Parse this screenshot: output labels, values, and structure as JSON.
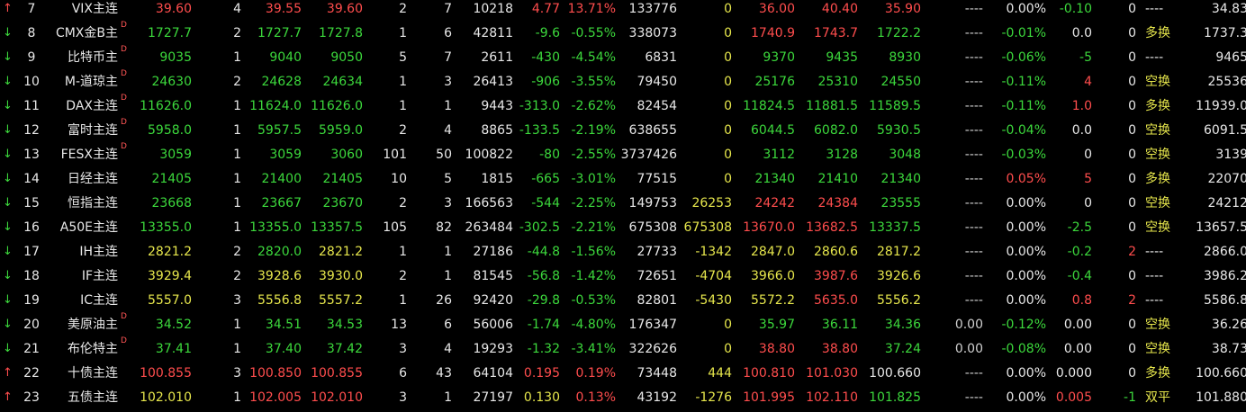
{
  "colors": {
    "background": "#000000",
    "up": "#ff4d4d",
    "down": "#3cd83c",
    "yellow": "#e6e64c",
    "white": "#e8e8e8"
  },
  "rows": [
    {
      "dir": "up",
      "idx": "7",
      "name": "VIX主连",
      "d": "",
      "last": "39.60",
      "lastc": "red",
      "bq": "4",
      "bid": "39.55",
      "bidc": "red",
      "ask": "39.60",
      "askc": "red",
      "aq": "2",
      "vol": "7",
      "total": "10218",
      "chg": "4.77",
      "chgc": "red",
      "pct": "13.71%",
      "pctc": "red",
      "oi": "133776",
      "oichg": "0",
      "oichgc": "yellow",
      "open": "36.00",
      "openc": "red",
      "high": "40.40",
      "highc": "red",
      "low": "35.90",
      "lowc": "red",
      "dash": "----",
      "zf": "0.00%",
      "zfc": "white",
      "diff": "-0.10",
      "diffc": "green",
      "n": "0",
      "nc": "white",
      "nature": "----",
      "naturec": "white",
      "extra": "34.83"
    },
    {
      "dir": "down",
      "idx": "8",
      "name": "CMX金B主",
      "d": "D",
      "last": "1727.7",
      "lastc": "green",
      "bq": "2",
      "bid": "1727.7",
      "bidc": "green",
      "ask": "1727.8",
      "askc": "green",
      "aq": "1",
      "vol": "6",
      "total": "42811",
      "chg": "-9.6",
      "chgc": "green",
      "pct": "-0.55%",
      "pctc": "green",
      "oi": "338073",
      "oichg": "0",
      "oichgc": "yellow",
      "open": "1740.9",
      "openc": "red",
      "high": "1743.7",
      "highc": "red",
      "low": "1722.2",
      "lowc": "green",
      "dash": "----",
      "zf": "-0.01%",
      "zfc": "green",
      "diff": "0.0",
      "diffc": "white",
      "n": "0",
      "nc": "white",
      "nature": "多换",
      "naturec": "yellow",
      "extra": "1737.3"
    },
    {
      "dir": "down",
      "idx": "9",
      "name": "比特币主",
      "d": "D",
      "last": "9035",
      "lastc": "green",
      "bq": "1",
      "bid": "9040",
      "bidc": "green",
      "ask": "9050",
      "askc": "green",
      "aq": "5",
      "vol": "7",
      "total": "2611",
      "chg": "-430",
      "chgc": "green",
      "pct": "-4.54%",
      "pctc": "green",
      "oi": "6831",
      "oichg": "0",
      "oichgc": "yellow",
      "open": "9370",
      "openc": "green",
      "high": "9435",
      "highc": "green",
      "low": "8930",
      "lowc": "green",
      "dash": "----",
      "zf": "-0.06%",
      "zfc": "green",
      "diff": "-5",
      "diffc": "green",
      "n": "0",
      "nc": "white",
      "nature": "----",
      "naturec": "white",
      "extra": "9465"
    },
    {
      "dir": "down",
      "idx": "10",
      "name": "M-道琼主",
      "d": "D",
      "last": "24630",
      "lastc": "green",
      "bq": "2",
      "bid": "24628",
      "bidc": "green",
      "ask": "24634",
      "askc": "green",
      "aq": "1",
      "vol": "3",
      "total": "26413",
      "chg": "-906",
      "chgc": "green",
      "pct": "-3.55%",
      "pctc": "green",
      "oi": "79450",
      "oichg": "0",
      "oichgc": "yellow",
      "open": "25176",
      "openc": "green",
      "high": "25310",
      "highc": "green",
      "low": "24550",
      "lowc": "green",
      "dash": "----",
      "zf": "-0.11%",
      "zfc": "green",
      "diff": "4",
      "diffc": "red",
      "n": "0",
      "nc": "white",
      "nature": "空换",
      "naturec": "yellow",
      "extra": "25536"
    },
    {
      "dir": "down",
      "idx": "11",
      "name": "DAX主连",
      "d": "D",
      "last": "11626.0",
      "lastc": "green",
      "bq": "1",
      "bid": "11624.0",
      "bidc": "green",
      "ask": "11626.0",
      "askc": "green",
      "aq": "1",
      "vol": "1",
      "total": "9443",
      "chg": "-313.0",
      "chgc": "green",
      "pct": "-2.62%",
      "pctc": "green",
      "oi": "82454",
      "oichg": "0",
      "oichgc": "yellow",
      "open": "11824.5",
      "openc": "green",
      "high": "11881.5",
      "highc": "green",
      "low": "11589.5",
      "lowc": "green",
      "dash": "----",
      "zf": "-0.11%",
      "zfc": "green",
      "diff": "1.0",
      "diffc": "red",
      "n": "0",
      "nc": "white",
      "nature": "多换",
      "naturec": "yellow",
      "extra": "11939.0"
    },
    {
      "dir": "down",
      "idx": "12",
      "name": "富时主连",
      "d": "D",
      "last": "5958.0",
      "lastc": "green",
      "bq": "1",
      "bid": "5957.5",
      "bidc": "green",
      "ask": "5959.0",
      "askc": "green",
      "aq": "2",
      "vol": "4",
      "total": "8865",
      "chg": "-133.5",
      "chgc": "green",
      "pct": "-2.19%",
      "pctc": "green",
      "oi": "638655",
      "oichg": "0",
      "oichgc": "yellow",
      "open": "6044.5",
      "openc": "green",
      "high": "6082.0",
      "highc": "green",
      "low": "5930.5",
      "lowc": "green",
      "dash": "----",
      "zf": "-0.04%",
      "zfc": "green",
      "diff": "0.0",
      "diffc": "white",
      "n": "0",
      "nc": "white",
      "nature": "空换",
      "naturec": "yellow",
      "extra": "6091.5"
    },
    {
      "dir": "down",
      "idx": "13",
      "name": "FESX主连",
      "d": "D",
      "last": "3059",
      "lastc": "green",
      "bq": "1",
      "bid": "3059",
      "bidc": "green",
      "ask": "3060",
      "askc": "green",
      "aq": "101",
      "vol": "50",
      "total": "100822",
      "chg": "-80",
      "chgc": "green",
      "pct": "-2.55%",
      "pctc": "green",
      "oi": "3737426",
      "oichg": "0",
      "oichgc": "yellow",
      "open": "3112",
      "openc": "green",
      "high": "3128",
      "highc": "green",
      "low": "3048",
      "lowc": "green",
      "dash": "----",
      "zf": "-0.03%",
      "zfc": "green",
      "diff": "0",
      "diffc": "white",
      "n": "0",
      "nc": "white",
      "nature": "空换",
      "naturec": "yellow",
      "extra": "3139"
    },
    {
      "dir": "down",
      "idx": "14",
      "name": "日经主连",
      "d": "",
      "last": "21405",
      "lastc": "green",
      "bq": "1",
      "bid": "21400",
      "bidc": "green",
      "ask": "21405",
      "askc": "green",
      "aq": "10",
      "vol": "5",
      "total": "1815",
      "chg": "-665",
      "chgc": "green",
      "pct": "-3.01%",
      "pctc": "green",
      "oi": "77515",
      "oichg": "0",
      "oichgc": "yellow",
      "open": "21340",
      "openc": "green",
      "high": "21410",
      "highc": "green",
      "low": "21340",
      "lowc": "green",
      "dash": "----",
      "zf": "0.05%",
      "zfc": "red",
      "diff": "5",
      "diffc": "red",
      "n": "0",
      "nc": "white",
      "nature": "多换",
      "naturec": "yellow",
      "extra": "22070"
    },
    {
      "dir": "down",
      "idx": "15",
      "name": "恒指主连",
      "d": "",
      "last": "23668",
      "lastc": "green",
      "bq": "1",
      "bid": "23667",
      "bidc": "green",
      "ask": "23670",
      "askc": "green",
      "aq": "2",
      "vol": "3",
      "total": "166563",
      "chg": "-544",
      "chgc": "green",
      "pct": "-2.25%",
      "pctc": "green",
      "oi": "149753",
      "oichg": "26253",
      "oichgc": "yellow",
      "open": "24242",
      "openc": "red",
      "high": "24384",
      "highc": "red",
      "low": "23555",
      "lowc": "green",
      "dash": "----",
      "zf": "0.00%",
      "zfc": "white",
      "diff": "0",
      "diffc": "white",
      "n": "0",
      "nc": "white",
      "nature": "空换",
      "naturec": "yellow",
      "extra": "24212"
    },
    {
      "dir": "down",
      "idx": "16",
      "name": "A50E主连",
      "d": "",
      "last": "13355.0",
      "lastc": "green",
      "bq": "1",
      "bid": "13355.0",
      "bidc": "green",
      "ask": "13357.5",
      "askc": "green",
      "aq": "105",
      "vol": "82",
      "total": "263484",
      "chg": "-302.5",
      "chgc": "green",
      "pct": "-2.21%",
      "pctc": "green",
      "oi": "675308",
      "oichg": "675308",
      "oichgc": "yellow",
      "open": "13670.0",
      "openc": "red",
      "high": "13682.5",
      "highc": "red",
      "low": "13337.5",
      "lowc": "green",
      "dash": "----",
      "zf": "0.00%",
      "zfc": "white",
      "diff": "-2.5",
      "diffc": "green",
      "n": "0",
      "nc": "white",
      "nature": "空换",
      "naturec": "yellow",
      "extra": "13657.5"
    },
    {
      "dir": "down",
      "idx": "17",
      "name": "IH主连",
      "d": "",
      "last": "2821.2",
      "lastc": "yellow",
      "bq": "2",
      "bid": "2820.0",
      "bidc": "green",
      "ask": "2821.2",
      "askc": "yellow",
      "aq": "1",
      "vol": "1",
      "total": "27186",
      "chg": "-44.8",
      "chgc": "green",
      "pct": "-1.56%",
      "pctc": "green",
      "oi": "27733",
      "oichg": "-1342",
      "oichgc": "yellow",
      "open": "2847.0",
      "openc": "yellow",
      "high": "2860.6",
      "highc": "yellow",
      "low": "2817.2",
      "lowc": "yellow",
      "dash": "----",
      "zf": "0.00%",
      "zfc": "white",
      "diff": "-0.2",
      "diffc": "green",
      "n": "2",
      "nc": "red",
      "nature": "----",
      "naturec": "white",
      "extra": "2866.0"
    },
    {
      "dir": "down",
      "idx": "18",
      "name": "IF主连",
      "d": "",
      "last": "3929.4",
      "lastc": "yellow",
      "bq": "2",
      "bid": "3928.6",
      "bidc": "yellow",
      "ask": "3930.0",
      "askc": "yellow",
      "aq": "2",
      "vol": "1",
      "total": "81545",
      "chg": "-56.8",
      "chgc": "green",
      "pct": "-1.42%",
      "pctc": "green",
      "oi": "72651",
      "oichg": "-4704",
      "oichgc": "yellow",
      "open": "3966.0",
      "openc": "yellow",
      "high": "3987.6",
      "highc": "red",
      "low": "3926.6",
      "lowc": "yellow",
      "dash": "----",
      "zf": "0.00%",
      "zfc": "white",
      "diff": "-0.4",
      "diffc": "green",
      "n": "0",
      "nc": "white",
      "nature": "----",
      "naturec": "white",
      "extra": "3986.2"
    },
    {
      "dir": "down",
      "idx": "19",
      "name": "IC主连",
      "d": "",
      "last": "5557.0",
      "lastc": "yellow",
      "bq": "3",
      "bid": "5556.8",
      "bidc": "yellow",
      "ask": "5557.2",
      "askc": "yellow",
      "aq": "1",
      "vol": "26",
      "total": "92420",
      "chg": "-29.8",
      "chgc": "green",
      "pct": "-0.53%",
      "pctc": "green",
      "oi": "82801",
      "oichg": "-5430",
      "oichgc": "yellow",
      "open": "5572.2",
      "openc": "yellow",
      "high": "5635.0",
      "highc": "red",
      "low": "5556.2",
      "lowc": "yellow",
      "dash": "----",
      "zf": "0.00%",
      "zfc": "white",
      "diff": "0.8",
      "diffc": "red",
      "n": "2",
      "nc": "red",
      "nature": "----",
      "naturec": "white",
      "extra": "5586.8"
    },
    {
      "dir": "down",
      "idx": "20",
      "name": "美原油主",
      "d": "D",
      "last": "34.52",
      "lastc": "green",
      "bq": "1",
      "bid": "34.51",
      "bidc": "green",
      "ask": "34.53",
      "askc": "green",
      "aq": "13",
      "vol": "6",
      "total": "56006",
      "chg": "-1.74",
      "chgc": "green",
      "pct": "-4.80%",
      "pctc": "green",
      "oi": "176347",
      "oichg": "0",
      "oichgc": "yellow",
      "open": "35.97",
      "openc": "green",
      "high": "36.11",
      "highc": "green",
      "low": "34.36",
      "lowc": "green",
      "dash": "0.00",
      "zf": "-0.12%",
      "zfc": "green",
      "diff": "0.00",
      "diffc": "white",
      "n": "0",
      "nc": "white",
      "nature": "空换",
      "naturec": "yellow",
      "extra": "36.26"
    },
    {
      "dir": "down",
      "idx": "21",
      "name": "布伦特主",
      "d": "D",
      "last": "37.41",
      "lastc": "green",
      "bq": "1",
      "bid": "37.40",
      "bidc": "green",
      "ask": "37.42",
      "askc": "green",
      "aq": "3",
      "vol": "4",
      "total": "19293",
      "chg": "-1.32",
      "chgc": "green",
      "pct": "-3.41%",
      "pctc": "green",
      "oi": "322626",
      "oichg": "0",
      "oichgc": "yellow",
      "open": "38.80",
      "openc": "red",
      "high": "38.80",
      "highc": "red",
      "low": "37.24",
      "lowc": "green",
      "dash": "0.00",
      "zf": "-0.08%",
      "zfc": "green",
      "diff": "0.00",
      "diffc": "white",
      "n": "0",
      "nc": "white",
      "nature": "空换",
      "naturec": "yellow",
      "extra": "38.73"
    },
    {
      "dir": "up",
      "idx": "22",
      "name": "十债主连",
      "d": "",
      "last": "100.855",
      "lastc": "red",
      "bq": "3",
      "bid": "100.850",
      "bidc": "red",
      "ask": "100.855",
      "askc": "red",
      "aq": "6",
      "vol": "43",
      "total": "64104",
      "chg": "0.195",
      "chgc": "red",
      "pct": "0.19%",
      "pctc": "red",
      "oi": "73448",
      "oichg": "444",
      "oichgc": "yellow",
      "open": "100.810",
      "openc": "red",
      "high": "101.030",
      "highc": "red",
      "low": "100.660",
      "lowc": "white",
      "dash": "----",
      "zf": "0.00%",
      "zfc": "white",
      "diff": "0.000",
      "diffc": "white",
      "n": "0",
      "nc": "white",
      "nature": "多换",
      "naturec": "yellow",
      "extra": "100.660"
    },
    {
      "dir": "up",
      "idx": "23",
      "name": "五债主连",
      "d": "",
      "last": "102.010",
      "lastc": "yellow",
      "bq": "1",
      "bid": "102.005",
      "bidc": "red",
      "ask": "102.010",
      "askc": "red",
      "aq": "3",
      "vol": "1",
      "total": "27197",
      "chg": "0.130",
      "chgc": "yellow",
      "pct": "0.13%",
      "pctc": "red",
      "oi": "43192",
      "oichg": "-1276",
      "oichgc": "yellow",
      "open": "101.995",
      "openc": "red",
      "high": "102.110",
      "highc": "red",
      "low": "101.825",
      "lowc": "green",
      "dash": "----",
      "zf": "0.00%",
      "zfc": "white",
      "diff": "0.005",
      "diffc": "red",
      "n": "-1",
      "nc": "green",
      "nature": "双平",
      "naturec": "yellow",
      "extra": "101.880"
    }
  ]
}
